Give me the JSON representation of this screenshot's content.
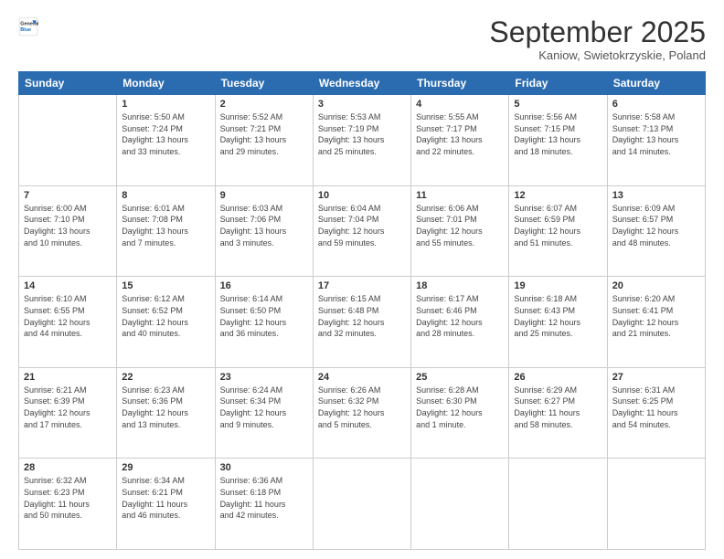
{
  "header": {
    "logo_general": "General",
    "logo_blue": "Blue",
    "month": "September 2025",
    "location": "Kaniow, Swietokrzyskie, Poland"
  },
  "days": [
    "Sunday",
    "Monday",
    "Tuesday",
    "Wednesday",
    "Thursday",
    "Friday",
    "Saturday"
  ],
  "weeks": [
    [
      {
        "day": "",
        "text": ""
      },
      {
        "day": "1",
        "text": "Sunrise: 5:50 AM\nSunset: 7:24 PM\nDaylight: 13 hours\nand 33 minutes."
      },
      {
        "day": "2",
        "text": "Sunrise: 5:52 AM\nSunset: 7:21 PM\nDaylight: 13 hours\nand 29 minutes."
      },
      {
        "day": "3",
        "text": "Sunrise: 5:53 AM\nSunset: 7:19 PM\nDaylight: 13 hours\nand 25 minutes."
      },
      {
        "day": "4",
        "text": "Sunrise: 5:55 AM\nSunset: 7:17 PM\nDaylight: 13 hours\nand 22 minutes."
      },
      {
        "day": "5",
        "text": "Sunrise: 5:56 AM\nSunset: 7:15 PM\nDaylight: 13 hours\nand 18 minutes."
      },
      {
        "day": "6",
        "text": "Sunrise: 5:58 AM\nSunset: 7:13 PM\nDaylight: 13 hours\nand 14 minutes."
      }
    ],
    [
      {
        "day": "7",
        "text": "Sunrise: 6:00 AM\nSunset: 7:10 PM\nDaylight: 13 hours\nand 10 minutes."
      },
      {
        "day": "8",
        "text": "Sunrise: 6:01 AM\nSunset: 7:08 PM\nDaylight: 13 hours\nand 7 minutes."
      },
      {
        "day": "9",
        "text": "Sunrise: 6:03 AM\nSunset: 7:06 PM\nDaylight: 13 hours\nand 3 minutes."
      },
      {
        "day": "10",
        "text": "Sunrise: 6:04 AM\nSunset: 7:04 PM\nDaylight: 12 hours\nand 59 minutes."
      },
      {
        "day": "11",
        "text": "Sunrise: 6:06 AM\nSunset: 7:01 PM\nDaylight: 12 hours\nand 55 minutes."
      },
      {
        "day": "12",
        "text": "Sunrise: 6:07 AM\nSunset: 6:59 PM\nDaylight: 12 hours\nand 51 minutes."
      },
      {
        "day": "13",
        "text": "Sunrise: 6:09 AM\nSunset: 6:57 PM\nDaylight: 12 hours\nand 48 minutes."
      }
    ],
    [
      {
        "day": "14",
        "text": "Sunrise: 6:10 AM\nSunset: 6:55 PM\nDaylight: 12 hours\nand 44 minutes."
      },
      {
        "day": "15",
        "text": "Sunrise: 6:12 AM\nSunset: 6:52 PM\nDaylight: 12 hours\nand 40 minutes."
      },
      {
        "day": "16",
        "text": "Sunrise: 6:14 AM\nSunset: 6:50 PM\nDaylight: 12 hours\nand 36 minutes."
      },
      {
        "day": "17",
        "text": "Sunrise: 6:15 AM\nSunset: 6:48 PM\nDaylight: 12 hours\nand 32 minutes."
      },
      {
        "day": "18",
        "text": "Sunrise: 6:17 AM\nSunset: 6:46 PM\nDaylight: 12 hours\nand 28 minutes."
      },
      {
        "day": "19",
        "text": "Sunrise: 6:18 AM\nSunset: 6:43 PM\nDaylight: 12 hours\nand 25 minutes."
      },
      {
        "day": "20",
        "text": "Sunrise: 6:20 AM\nSunset: 6:41 PM\nDaylight: 12 hours\nand 21 minutes."
      }
    ],
    [
      {
        "day": "21",
        "text": "Sunrise: 6:21 AM\nSunset: 6:39 PM\nDaylight: 12 hours\nand 17 minutes."
      },
      {
        "day": "22",
        "text": "Sunrise: 6:23 AM\nSunset: 6:36 PM\nDaylight: 12 hours\nand 13 minutes."
      },
      {
        "day": "23",
        "text": "Sunrise: 6:24 AM\nSunset: 6:34 PM\nDaylight: 12 hours\nand 9 minutes."
      },
      {
        "day": "24",
        "text": "Sunrise: 6:26 AM\nSunset: 6:32 PM\nDaylight: 12 hours\nand 5 minutes."
      },
      {
        "day": "25",
        "text": "Sunrise: 6:28 AM\nSunset: 6:30 PM\nDaylight: 12 hours\nand 1 minute."
      },
      {
        "day": "26",
        "text": "Sunrise: 6:29 AM\nSunset: 6:27 PM\nDaylight: 11 hours\nand 58 minutes."
      },
      {
        "day": "27",
        "text": "Sunrise: 6:31 AM\nSunset: 6:25 PM\nDaylight: 11 hours\nand 54 minutes."
      }
    ],
    [
      {
        "day": "28",
        "text": "Sunrise: 6:32 AM\nSunset: 6:23 PM\nDaylight: 11 hours\nand 50 minutes."
      },
      {
        "day": "29",
        "text": "Sunrise: 6:34 AM\nSunset: 6:21 PM\nDaylight: 11 hours\nand 46 minutes."
      },
      {
        "day": "30",
        "text": "Sunrise: 6:36 AM\nSunset: 6:18 PM\nDaylight: 11 hours\nand 42 minutes."
      },
      {
        "day": "",
        "text": ""
      },
      {
        "day": "",
        "text": ""
      },
      {
        "day": "",
        "text": ""
      },
      {
        "day": "",
        "text": ""
      }
    ]
  ]
}
